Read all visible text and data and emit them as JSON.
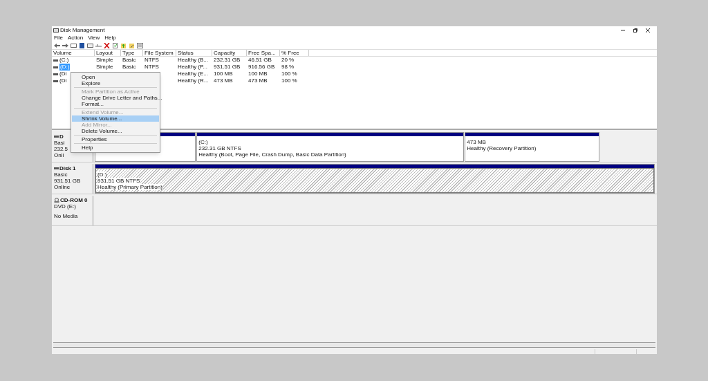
{
  "window": {
    "title": "Disk Management"
  },
  "menu_bar": [
    "File",
    "Action",
    "View",
    "Help"
  ],
  "volume_table": {
    "columns": [
      "Volume",
      "Layout",
      "Type",
      "File System",
      "Status",
      "Capacity",
      "Free Spa...",
      "% Free"
    ],
    "rows": [
      {
        "selected": false,
        "cells": [
          "(C:)",
          "Simple",
          "Basic",
          "NTFS",
          "Healthy (B...",
          "232.31 GB",
          "46.51 GB",
          "20 %"
        ]
      },
      {
        "selected": true,
        "cells": [
          "(D:)",
          "Simple",
          "Basic",
          "NTFS",
          "Healthy (P...",
          "931.51 GB",
          "916.56 GB",
          "98 %"
        ]
      },
      {
        "selected": false,
        "cells": [
          "(Di",
          "",
          "",
          "",
          "Healthy (E...",
          "100 MB",
          "100 MB",
          "100 %"
        ]
      },
      {
        "selected": false,
        "cells": [
          "(Di",
          "",
          "",
          "",
          "Healthy (R...",
          "473 MB",
          "473 MB",
          "100 %"
        ]
      }
    ]
  },
  "context_menu": [
    {
      "kind": "item",
      "label": "Open",
      "disabled": false,
      "selected": false
    },
    {
      "kind": "item",
      "label": "Explore",
      "disabled": false,
      "selected": false
    },
    {
      "kind": "separator"
    },
    {
      "kind": "item",
      "label": "Mark Partition as Active",
      "disabled": true,
      "selected": false
    },
    {
      "kind": "item",
      "label": "Change Drive Letter and Paths...",
      "disabled": false,
      "selected": false
    },
    {
      "kind": "item",
      "label": "Format...",
      "disabled": false,
      "selected": false
    },
    {
      "kind": "separator"
    },
    {
      "kind": "item",
      "label": "Extend Volume...",
      "disabled": true,
      "selected": false
    },
    {
      "kind": "item",
      "label": "Shrink Volume...",
      "disabled": false,
      "selected": true
    },
    {
      "kind": "item",
      "label": "Add Mirror...",
      "disabled": true,
      "selected": false
    },
    {
      "kind": "item",
      "label": "Delete Volume...",
      "disabled": false,
      "selected": false
    },
    {
      "kind": "separator"
    },
    {
      "kind": "item",
      "label": "Properties",
      "disabled": false,
      "selected": false
    },
    {
      "kind": "separator"
    },
    {
      "kind": "item",
      "label": "Help",
      "disabled": false,
      "selected": false
    }
  ],
  "disks": [
    {
      "kind": "disk",
      "name": "D",
      "lines": [
        "Basi",
        "232.5",
        "Onli"
      ],
      "partitions": [
        {
          "selected": false
        },
        {
          "selected": false,
          "lines": [
            "(C:)",
            "232.31 GB NTFS",
            "Healthy (Boot, Page File, Crash Dump, Basic Data Partition)"
          ]
        },
        {
          "selected": false,
          "lines": [
            "473 MB",
            "Healthy (Recovery Partition)"
          ]
        }
      ]
    },
    {
      "kind": "disk",
      "name": "Disk 1",
      "lines": [
        "Basic",
        "931.51 GB",
        "Online"
      ],
      "partitions": [
        {
          "selected": true,
          "lines": [
            "(D:)",
            "931.51 GB NTFS",
            "Healthy (Primary Partition)"
          ]
        }
      ]
    },
    {
      "kind": "cdrom",
      "name": "CD-ROM 0",
      "lines": [
        "DVD (E:)",
        "No Media"
      ]
    }
  ]
}
